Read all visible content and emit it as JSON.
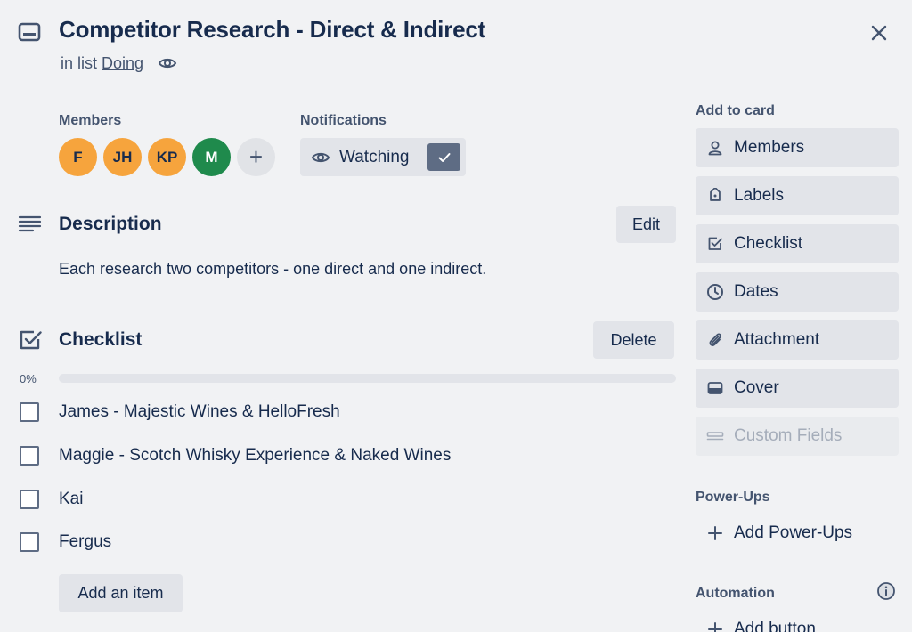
{
  "card": {
    "title": "Competitor Research - Direct & Indirect",
    "list_prefix": "in list",
    "list_name": "Doing"
  },
  "members": {
    "label": "Members",
    "avatars": [
      {
        "initials": "F",
        "color": "#f6a43d"
      },
      {
        "initials": "JH",
        "color": "#f6a43d"
      },
      {
        "initials": "KP",
        "color": "#f6a43d"
      },
      {
        "initials": "M",
        "color": "#1f8a4c"
      }
    ],
    "add_glyph": "+"
  },
  "notifications": {
    "label": "Notifications",
    "watch_label": "Watching"
  },
  "description": {
    "title": "Description",
    "edit_label": "Edit",
    "text": "Each research two competitors - one direct and one indirect."
  },
  "checklist": {
    "title": "Checklist",
    "delete_label": "Delete",
    "progress_text": "0%",
    "progress_percent": 0,
    "items": [
      {
        "label": "James - Majestic Wines & HelloFresh",
        "checked": false
      },
      {
        "label": "Maggie - Scotch Whisky Experience & Naked Wines",
        "checked": false
      },
      {
        "label": "Kai",
        "checked": false
      },
      {
        "label": "Fergus",
        "checked": false
      }
    ],
    "add_item_label": "Add an item"
  },
  "sidebar": {
    "add_to_card_label": "Add to card",
    "buttons": [
      {
        "label": "Members",
        "icon": "person-icon"
      },
      {
        "label": "Labels",
        "icon": "tag-icon"
      },
      {
        "label": "Checklist",
        "icon": "checkbox-icon"
      },
      {
        "label": "Dates",
        "icon": "clock-icon"
      },
      {
        "label": "Attachment",
        "icon": "paperclip-icon"
      },
      {
        "label": "Cover",
        "icon": "cover-icon"
      },
      {
        "label": "Custom Fields",
        "icon": "custom-fields-icon",
        "disabled": true
      }
    ],
    "powerups_label": "Power-Ups",
    "add_powerups_label": "Add Power-Ups",
    "automation_label": "Automation",
    "add_button_label": "Add button"
  },
  "colors": {
    "background": "#f1f2f4",
    "button_bg": "#e2e4e9",
    "text": "#172b4d",
    "subtle_text": "#44546f",
    "watch_check_bg": "#5e6c84"
  }
}
